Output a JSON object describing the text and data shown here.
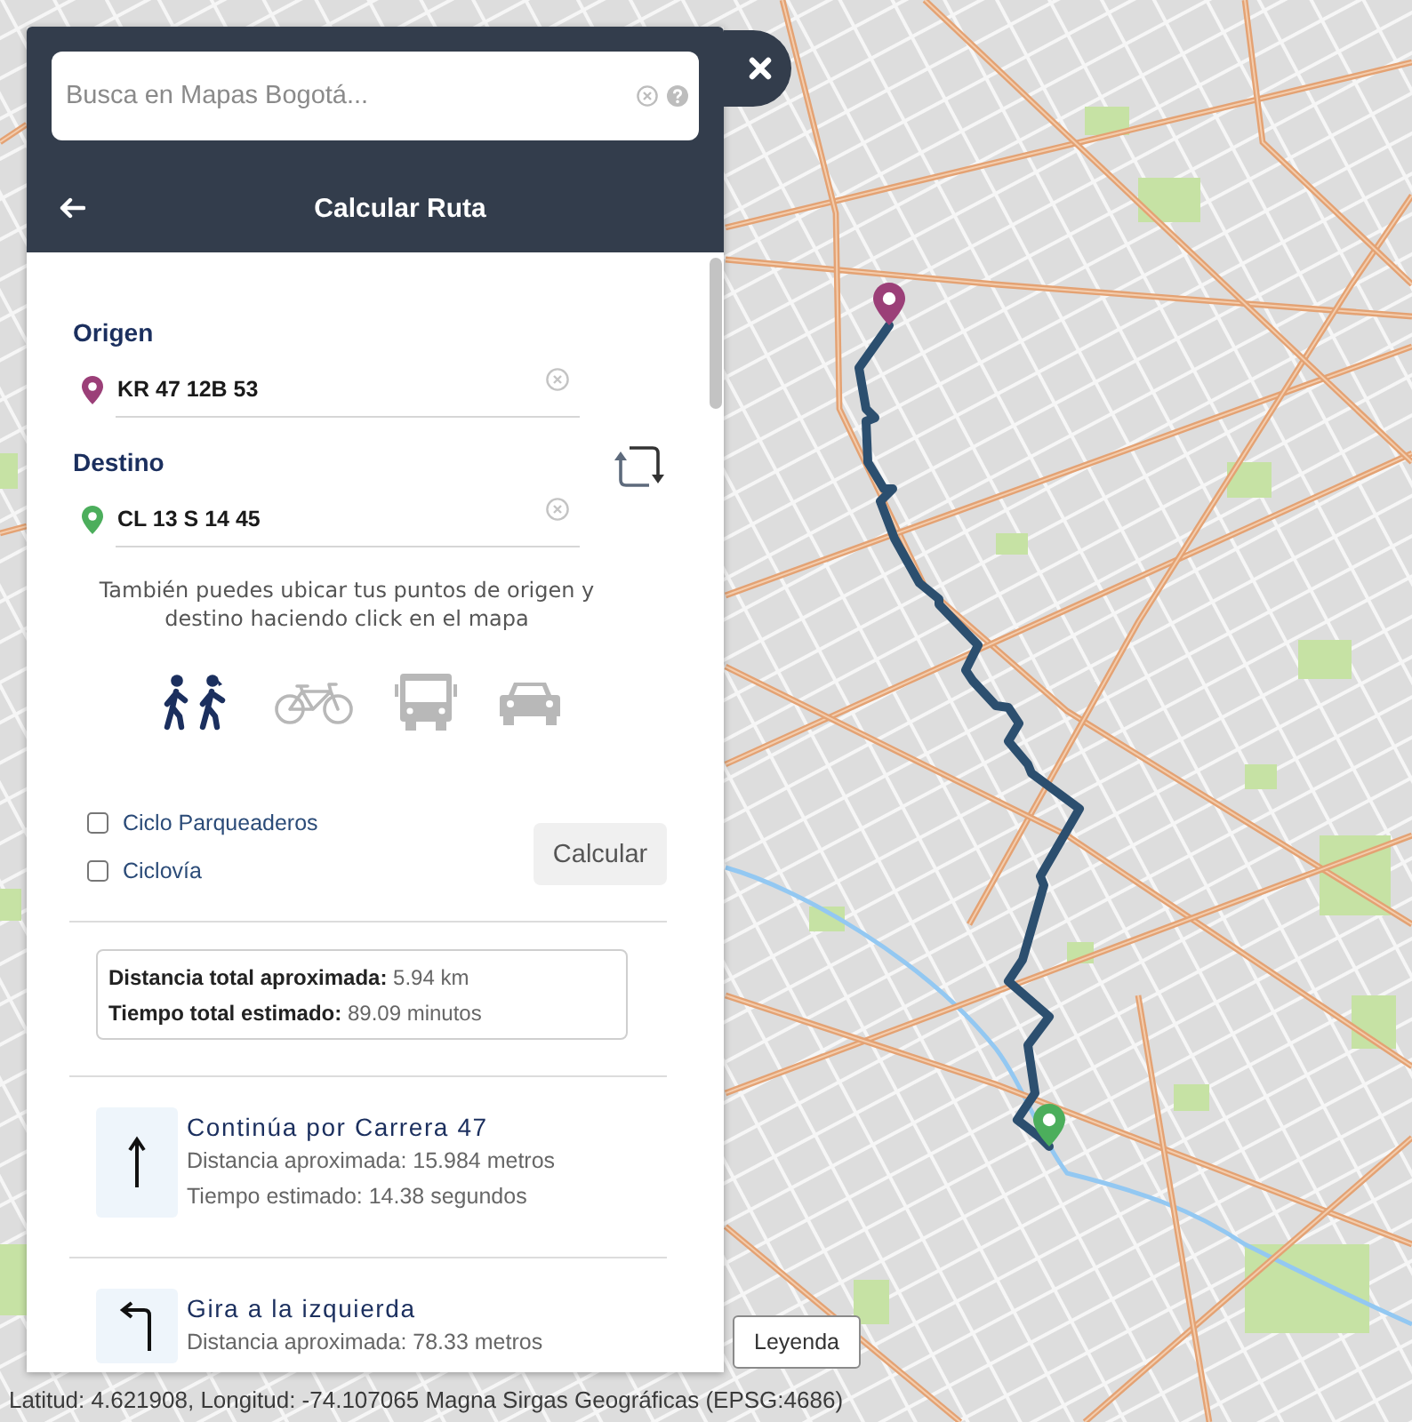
{
  "search": {
    "placeholder": "Busca en Mapas Bogotá..."
  },
  "header": {
    "title": "Calcular Ruta"
  },
  "fields": [
    {
      "label": "Origen",
      "value": "KR 47 12B 53",
      "color": "#9b3f78"
    },
    {
      "label": "Destino",
      "value": "CL 13 S 14 45",
      "color": "#4cae5c"
    }
  ],
  "hint": "También puedes ubicar tus puntos de origen y destino haciendo click en el mapa",
  "modes": [
    {
      "kind": "walk",
      "selected": true
    },
    {
      "kind": "bike",
      "selected": false
    },
    {
      "kind": "bus",
      "selected": false
    },
    {
      "kind": "car",
      "selected": false
    }
  ],
  "options": [
    {
      "label": "Ciclo Parqueaderos",
      "checked": false
    },
    {
      "label": "Ciclovía",
      "checked": false
    }
  ],
  "calculate_button": "Calcular",
  "summary": [
    "**Distancia total aproximada:** 5.94 km",
    "**Tiempo total estimado:** 89.09 minutos"
  ],
  "steps": [
    {
      "kind": "straight",
      "title": "Continúa por Carrera 47",
      "lines": [
        "Distancia aproximada: 15.984 metros",
        "Tiempo estimado: 14.38 segundos"
      ]
    },
    {
      "kind": "left",
      "title": "Gira a la izquierda",
      "lines": [
        "Distancia aproximada: 78.33 metros"
      ]
    }
  ],
  "map": {
    "legend_button": "Leyenda"
  },
  "status_bar": "Latitud: 4.621908, Longitud: -74.107065 Magna Sirgas Geográficas (EPSG:4686)"
}
